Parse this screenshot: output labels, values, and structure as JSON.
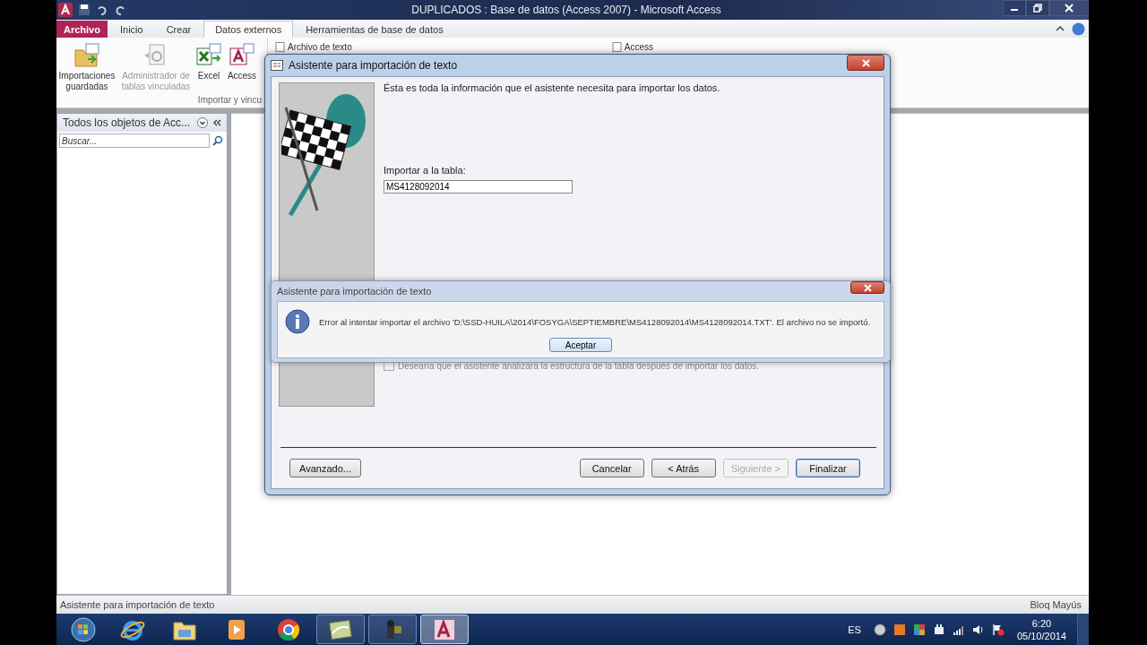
{
  "window": {
    "title": "DUPLICADOS : Base de datos (Access 2007)  -  Microsoft Access"
  },
  "ribbon_tabs": [
    {
      "label": "Archivo",
      "kind": "file",
      "selected": false
    },
    {
      "label": "Inicio",
      "kind": "tab",
      "selected": false
    },
    {
      "label": "Crear",
      "kind": "tab",
      "selected": false
    },
    {
      "label": "Datos externos",
      "kind": "tab",
      "selected": true
    },
    {
      "label": "Herramientas de base de datos",
      "kind": "tab",
      "selected": false
    }
  ],
  "ribbon": {
    "large_buttons": [
      {
        "label": "Importaciones guardadas",
        "kind": "saved",
        "disabled": false
      },
      {
        "label": "Administrador de tablas vinculadas",
        "kind": "linked",
        "disabled": true
      },
      {
        "label": "Excel",
        "kind": "excel",
        "disabled": false
      },
      {
        "label": "Access",
        "kind": "access",
        "disabled": false
      }
    ],
    "small_buttons": [
      "Archivo de texto",
      "Access"
    ],
    "group_label": "Importar y vincu"
  },
  "nav_pane": {
    "title": "Todos los objetos de Acc...",
    "search": {
      "placeholder": "Buscar..."
    }
  },
  "wizard": {
    "title": "Asistente para importación de texto",
    "intro": "Ésta es toda la información que el asistente necesita para importar los datos.",
    "table_label": "Importar a la tabla:",
    "table_name": "MS4128092014",
    "analyze": {
      "label": "Desearía que el asistente analizara la estructura de la tabla después de importar los datos.",
      "checked": false
    },
    "buttons": [
      {
        "label": "Avanzado...",
        "disabled": false,
        "default": false
      },
      {
        "label": "Cancelar",
        "disabled": false,
        "default": false
      },
      {
        "label": "< Atrás",
        "disabled": false,
        "default": false
      },
      {
        "label": "Siguiente >",
        "disabled": true,
        "default": false
      },
      {
        "label": "Finalizar",
        "disabled": false,
        "default": true
      }
    ]
  },
  "error_dialog": {
    "title": "Asistente para importación de texto",
    "message": "Error al intentar importar el archivo 'D:\\SSD-HUILA\\2014\\FOSYGA\\SEPTIEMBRE\\MS4128092014\\MS4128092014.TXT'. El archivo no se importó.",
    "button": "Aceptar"
  },
  "status_bar": {
    "left": "Asistente para importación de texto",
    "right": "Bloq Mayús"
  },
  "taskbar": {
    "apps": [
      {
        "kind": "start",
        "running": false,
        "selected": false
      },
      {
        "kind": "ie",
        "running": false,
        "selected": false
      },
      {
        "kind": "folder",
        "running": false,
        "selected": false
      },
      {
        "kind": "media",
        "running": false,
        "selected": false
      },
      {
        "kind": "chrome",
        "running": false,
        "selected": false
      },
      {
        "kind": "image",
        "running": true,
        "selected": false
      },
      {
        "kind": "camera",
        "running": true,
        "selected": false
      },
      {
        "kind": "access",
        "running": true,
        "selected": true
      }
    ],
    "language": "ES",
    "time": "6:20",
    "date": "05/10/2014"
  }
}
